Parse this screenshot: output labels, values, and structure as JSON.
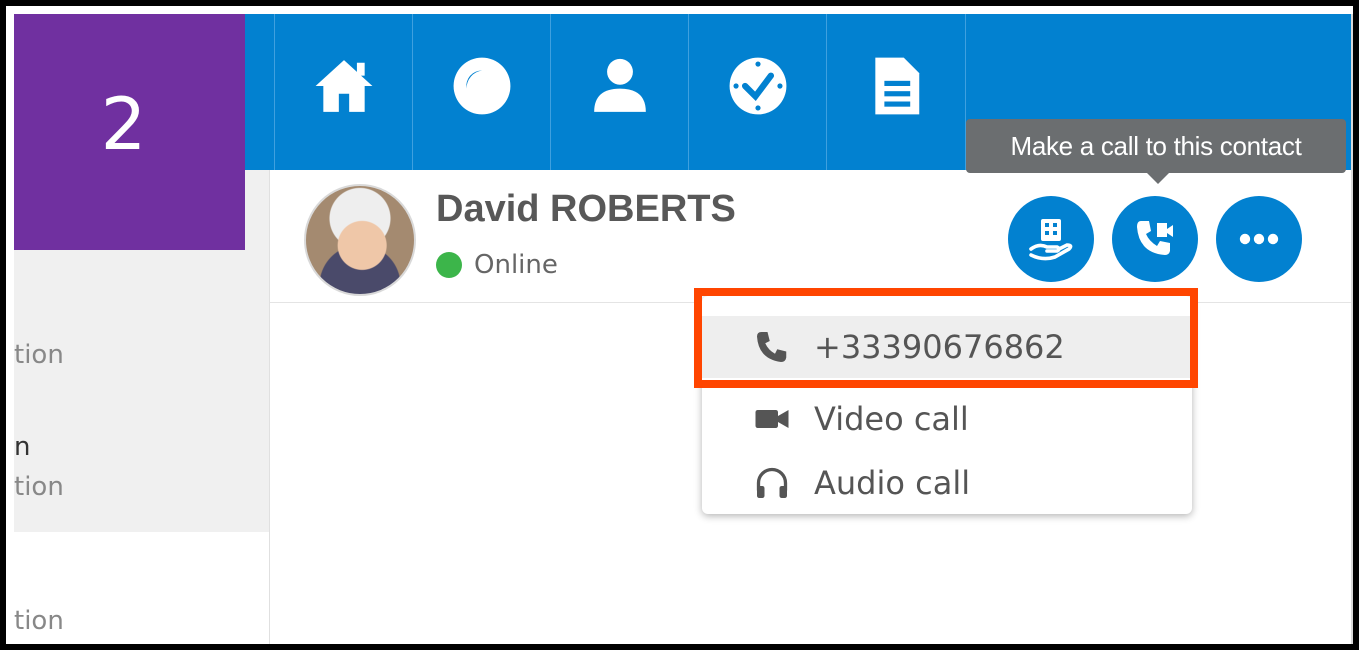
{
  "left_panel": {
    "badge_number": "2",
    "items": [
      {
        "title": "",
        "subtitle": "tion"
      },
      {
        "title": "n",
        "subtitle": "tion"
      },
      {
        "title": "",
        "subtitle": "tion"
      }
    ]
  },
  "navbar": {
    "items": [
      {
        "icon": "home-icon"
      },
      {
        "icon": "bubble-icon"
      },
      {
        "icon": "person-icon"
      },
      {
        "icon": "clock-icon"
      },
      {
        "icon": "document-icon"
      }
    ]
  },
  "contact": {
    "name": "David ROBERTS",
    "status": "Online",
    "status_color": "#3cb54a"
  },
  "actions": {
    "tooltip": "Make a call to this contact"
  },
  "call_menu": {
    "phone_number": "+33390676862",
    "video_label": "Video call",
    "audio_label": "Audio call"
  },
  "colors": {
    "brand_blue": "#0281d0",
    "purple": "#7030a0",
    "highlight": "#ff4500"
  }
}
